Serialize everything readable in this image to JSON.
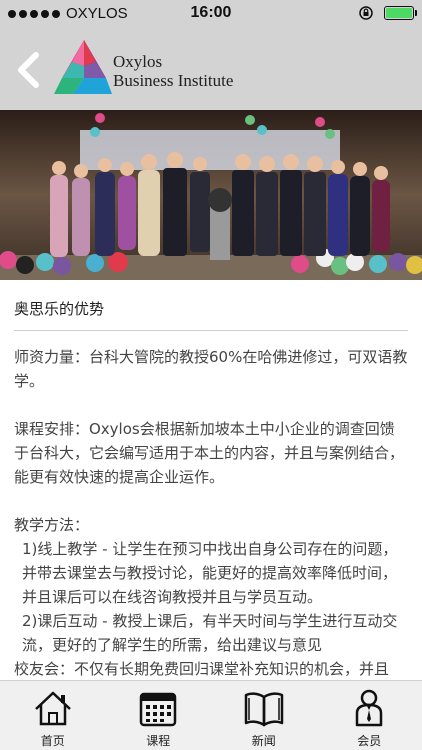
{
  "status_bar": {
    "carrier": "OXYLOS",
    "time": "16:00",
    "battery_level": 1.0
  },
  "header": {
    "logo_line1": "Oxylos",
    "logo_line2": "Business Institute"
  },
  "content": {
    "section_title": "奥思乐的优势",
    "paragraphs": [
      "师资力量：台科大管院的教授60%在哈佛进修过，可双语教学。",
      "课程安排：Oxylos会根据新加坡本土中小企业的调查回馈于台科大，它会编写适用于本土的内容，并且与案例结合，能更有效快速的提高企业运作。"
    ],
    "method_title": "教学方法：",
    "method_1": "1)线上教学 - 让学生在预习中找出自身公司存在的问题，并带去课堂去与教授讨论，能更好的提高效率降低时间，并且课后可以在线咨询教授并且与学员互动。",
    "method_2": "2)课后互动 - 教授上课后，有半天时间与学生进行互动交流，更好的了解学生的所需，给出建议与意见",
    "alumni": "校友会：不仅有长期免费回归课堂补充知识的机会，并且"
  },
  "tabbar": {
    "items": [
      {
        "label": "首页",
        "icon": "home-icon"
      },
      {
        "label": "课程",
        "icon": "calendar-icon"
      },
      {
        "label": "新闻",
        "icon": "book-icon"
      },
      {
        "label": "会员",
        "icon": "member-icon"
      }
    ]
  }
}
